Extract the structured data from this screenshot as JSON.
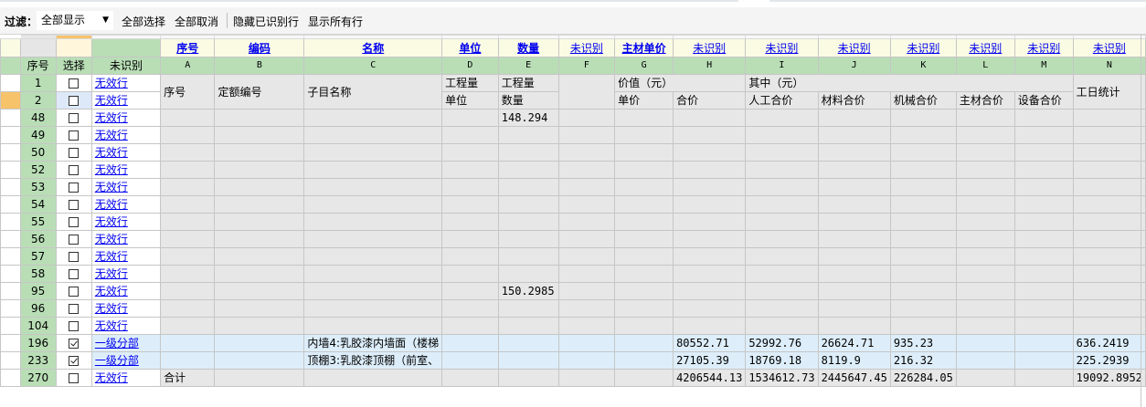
{
  "toolbar": {
    "filter_label": "过滤：",
    "filter_value": "全部显示",
    "select_all": "全部选择",
    "deselect_all": "全部取消",
    "hide_identified": "隐藏已识别行",
    "show_all_rows": "显示所有行"
  },
  "header_row1": [
    "序号",
    "编码",
    "名称",
    "单位",
    "数量",
    "未识别",
    "主材单价",
    "未识别",
    "未识别",
    "未识别",
    "未识别",
    "未识别",
    "未识别",
    "未识别"
  ],
  "header_row1_bold": [
    true,
    true,
    true,
    true,
    true,
    false,
    true,
    false,
    false,
    false,
    false,
    false,
    false,
    false
  ],
  "header_row2_fixed": [
    "序号",
    "选择",
    "未识别"
  ],
  "column_letters": [
    "A",
    "B",
    "C",
    "D",
    "E",
    "F",
    "G",
    "H",
    "I",
    "J",
    "K",
    "L",
    "M",
    "N"
  ],
  "data_header_rows": {
    "row1": {
      "seq": "1",
      "link": "无效行",
      "A": "序号",
      "B": "定额编号",
      "C": "子目名称",
      "D": "工程量",
      "E": "工程量",
      "G": "价值（元）",
      "I": "其中（元）",
      "N": "工日统计"
    },
    "row2": {
      "seq": "2",
      "link": "无效行",
      "D": "单位",
      "E": "数量",
      "G": "单价",
      "H": "合价",
      "I": "人工合价",
      "J": "材料合价",
      "K": "机械合价",
      "L": "主材合价",
      "M": "设备合价"
    }
  },
  "rows": [
    {
      "seq": "48",
      "checked": false,
      "link": "无效行",
      "E": "148.294"
    },
    {
      "seq": "49",
      "checked": false,
      "link": "无效行"
    },
    {
      "seq": "50",
      "checked": false,
      "link": "无效行"
    },
    {
      "seq": "52",
      "checked": false,
      "link": "无效行"
    },
    {
      "seq": "53",
      "checked": false,
      "link": "无效行"
    },
    {
      "seq": "54",
      "checked": false,
      "link": "无效行"
    },
    {
      "seq": "55",
      "checked": false,
      "link": "无效行"
    },
    {
      "seq": "56",
      "checked": false,
      "link": "无效行"
    },
    {
      "seq": "57",
      "checked": false,
      "link": "无效行"
    },
    {
      "seq": "58",
      "checked": false,
      "link": "无效行"
    },
    {
      "seq": "95",
      "checked": false,
      "link": "无效行",
      "E": "150.2985"
    },
    {
      "seq": "96",
      "checked": false,
      "link": "无效行"
    },
    {
      "seq": "104",
      "checked": false,
      "link": "无效行"
    },
    {
      "seq": "196",
      "checked": true,
      "link": "一级分部",
      "blue": true,
      "C": "内墙4:乳胶漆内墙面（楼梯",
      "H": "80552.71",
      "I": "52992.76",
      "J": "26624.71",
      "K": "935.23",
      "N": "636.2419"
    },
    {
      "seq": "233",
      "checked": true,
      "link": "一级分部",
      "blue": true,
      "C": "顶棚3:乳胶漆顶棚（前室、",
      "H": "27105.39",
      "I": "18769.18",
      "J": "8119.9",
      "K": "216.32",
      "N": "225.2939"
    },
    {
      "seq": "270",
      "checked": false,
      "link": "无效行",
      "A": "合计",
      "H": "4206544.13",
      "I": "1534612.73",
      "J": "2445647.45",
      "K": "226284.05",
      "N": "19092.8952"
    }
  ]
}
